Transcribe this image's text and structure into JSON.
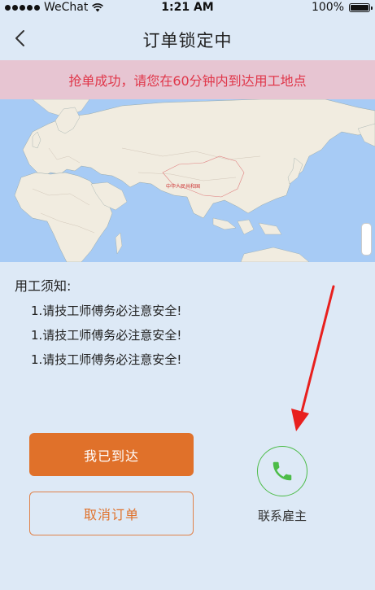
{
  "status_bar": {
    "carrier": "WeChat",
    "time": "1:21 AM",
    "battery": "100%"
  },
  "nav": {
    "title": "订单锁定中"
  },
  "notice": {
    "text": "抢单成功，请您在60分钟内到达用工地点"
  },
  "map": {
    "label": "中华人民共和国"
  },
  "notes": {
    "title": "用工须知:",
    "items": [
      "1.请技工师傅务必注意安全!",
      "1.请技工师傅务必注意安全!",
      "1.请技工师傅务必注意安全!"
    ]
  },
  "actions": {
    "arrived_label": "我已到达",
    "cancel_label": "取消订单",
    "contact_label": "联系雇主"
  },
  "colors": {
    "accent_orange": "#e0712a",
    "phone_green": "#4cbc48",
    "notice_red": "#e0374a",
    "background": "#dde9f6"
  }
}
